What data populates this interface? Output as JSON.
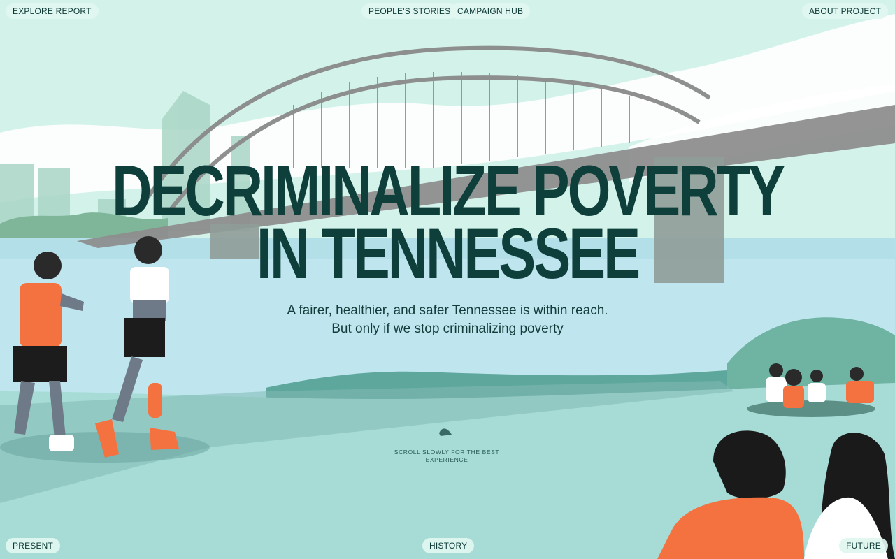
{
  "nav": {
    "explore": "EXPLORE REPORT",
    "stories": "PEOPLE'S STORIES",
    "campaign": "CAMPAIGN HUB",
    "about": "ABOUT PROJECT"
  },
  "hero": {
    "title_line1": "DECRIMINALIZE POVERTY",
    "title_line2": "IN TENNESSEE",
    "subtitle_line1": "A fairer, healthier, and safer Tennessee is within reach.",
    "subtitle_line2": "But only if we stop criminalizing poverty",
    "scroll_hint": "SCROLL SLOWLY FOR THE BEST EXPERIENCE"
  },
  "timeline": {
    "present": "PRESENT",
    "history": "HISTORY",
    "future": "FUTURE"
  },
  "colors": {
    "sky": "#d3f3ea",
    "river": "#bfe6ef",
    "ground": "#a7dcd6",
    "headline": "#0e3f3b",
    "accent_orange": "#f47140"
  }
}
